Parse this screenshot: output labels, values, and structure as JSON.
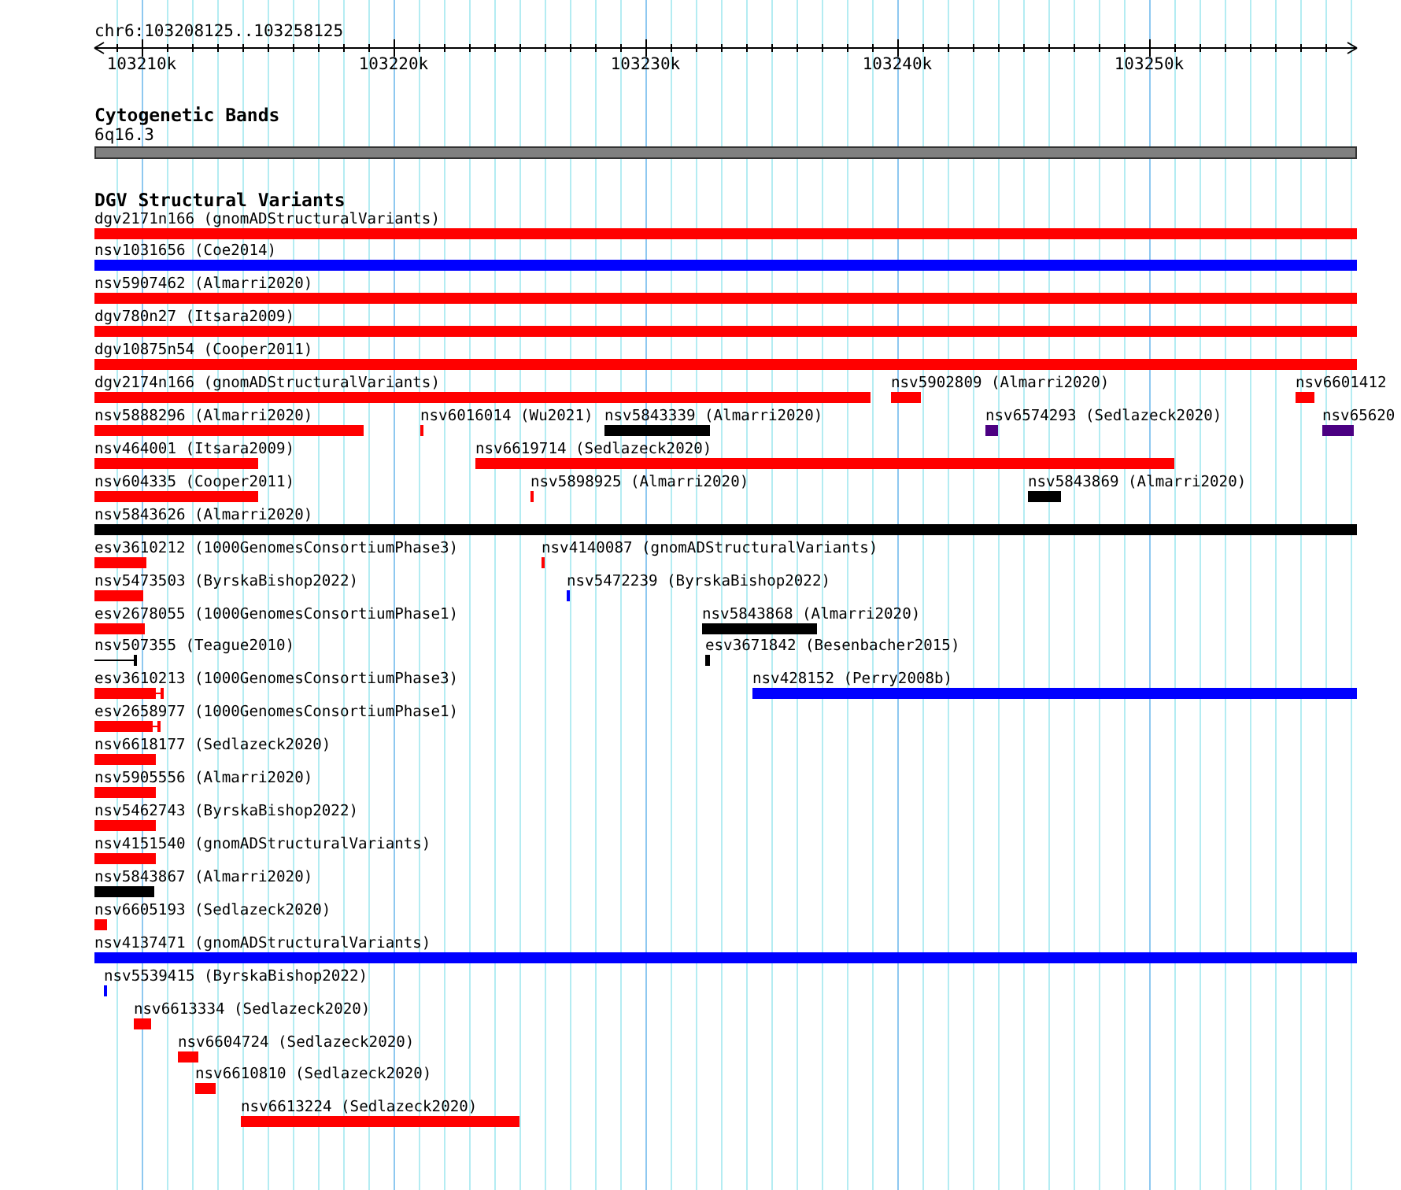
{
  "ruler": {
    "location": "chr6:103208125..103258125",
    "ticks": [
      "103210k",
      "103220k",
      "103230k",
      "103240k",
      "103250k"
    ]
  },
  "cytogenetic_track": {
    "title": "Cytogenetic Bands",
    "band": "6q16.3"
  },
  "dgv_track": {
    "title": "DGV Structural Variants",
    "features": [
      {
        "label": "dgv2171n166 (gnomADStructuralVariants)",
        "color": "#ff0000",
        "kind": "bar"
      },
      {
        "label": "nsv1031656 (Coe2014)",
        "color": "#0000ff",
        "kind": "bar"
      },
      {
        "label": "nsv5907462 (Almarri2020)",
        "color": "#ff0000",
        "kind": "bar"
      },
      {
        "label": "dgv780n27 (Itsara2009)",
        "color": "#ff0000",
        "kind": "bar"
      },
      {
        "label": "dgv10875n54 (Cooper2011)",
        "color": "#ff0000",
        "kind": "bar"
      },
      {
        "label": "dgv2174n166 (gnomADStructuralVariants)",
        "color": "#ff0000",
        "kind": "bar"
      },
      {
        "label": "nsv5902809 (Almarri2020)",
        "color": "#ff0000",
        "kind": "bar"
      },
      {
        "label": "nsv6601412",
        "color": "#ff0000",
        "kind": "bar"
      },
      {
        "label": "nsv5888296 (Almarri2020)",
        "color": "#ff0000",
        "kind": "bar"
      },
      {
        "label": "nsv6016014 (Wu2021)",
        "color": "#ff0000",
        "kind": "bar"
      },
      {
        "label": "nsv5843339 (Almarri2020)",
        "color": "#000000",
        "kind": "bar"
      },
      {
        "label": "nsv6574293 (Sedlazeck2020)",
        "color": "#4b0082",
        "kind": "bar"
      },
      {
        "label": "nsv65620",
        "color": "#4b0082",
        "kind": "bar"
      },
      {
        "label": "nsv464001 (Itsara2009)",
        "color": "#ff0000",
        "kind": "bar"
      },
      {
        "label": "nsv6619714 (Sedlazeck2020)",
        "color": "#ff0000",
        "kind": "bar"
      },
      {
        "label": "nsv604335 (Cooper2011)",
        "color": "#ff0000",
        "kind": "bar"
      },
      {
        "label": "nsv5898925 (Almarri2020)",
        "color": "#ff0000",
        "kind": "bar"
      },
      {
        "label": "nsv5843869 (Almarri2020)",
        "color": "#000000",
        "kind": "bar"
      },
      {
        "label": "nsv5843626 (Almarri2020)",
        "color": "#000000",
        "kind": "bar"
      },
      {
        "label": "esv3610212 (1000GenomesConsortiumPhase3)",
        "color": "#ff0000",
        "kind": "bar"
      },
      {
        "label": "nsv4140087 (gnomADStructuralVariants)",
        "color": "#ff0000",
        "kind": "bar"
      },
      {
        "label": "nsv5473503 (ByrskaBishop2022)",
        "color": "#ff0000",
        "kind": "bar"
      },
      {
        "label": "nsv5472239 (ByrskaBishop2022)",
        "color": "#0000ff",
        "kind": "bar"
      },
      {
        "label": "esv2678055 (1000GenomesConsortiumPhase1)",
        "color": "#ff0000",
        "kind": "bar"
      },
      {
        "label": "nsv5843868 (Almarri2020)",
        "color": "#000000",
        "kind": "bar"
      },
      {
        "label": "nsv507355 (Teague2010)",
        "color": "#000000",
        "kind": "line"
      },
      {
        "label": "esv3671842 (Besenbacher2015)",
        "color": "#000000",
        "kind": "bar"
      },
      {
        "label": "esv3610213 (1000GenomesConsortiumPhase3)",
        "color": "#ff0000",
        "kind": "capped"
      },
      {
        "label": "nsv428152 (Perry2008b)",
        "color": "#0000ff",
        "kind": "bar"
      },
      {
        "label": "esv2658977 (1000GenomesConsortiumPhase1)",
        "color": "#ff0000",
        "kind": "capped"
      },
      {
        "label": "nsv6618177 (Sedlazeck2020)",
        "color": "#ff0000",
        "kind": "bar"
      },
      {
        "label": "nsv5905556 (Almarri2020)",
        "color": "#ff0000",
        "kind": "bar"
      },
      {
        "label": "nsv5462743 (ByrskaBishop2022)",
        "color": "#ff0000",
        "kind": "bar"
      },
      {
        "label": "nsv4151540 (gnomADStructuralVariants)",
        "color": "#ff0000",
        "kind": "bar"
      },
      {
        "label": "nsv5843867 (Almarri2020)",
        "color": "#000000",
        "kind": "bar"
      },
      {
        "label": "nsv6605193 (Sedlazeck2020)",
        "color": "#ff0000",
        "kind": "bar"
      },
      {
        "label": "nsv4137471 (gnomADStructuralVariants)",
        "color": "#0000ff",
        "kind": "bar"
      },
      {
        "label": "nsv5539415 (ByrskaBishop2022)",
        "color": "#0000ff",
        "kind": "bar"
      },
      {
        "label": "nsv6613334 (Sedlazeck2020)",
        "color": "#ff0000",
        "kind": "bar"
      },
      {
        "label": "nsv6604724 (Sedlazeck2020)",
        "color": "#ff0000",
        "kind": "bar"
      },
      {
        "label": "nsv6610810 (Sedlazeck2020)",
        "color": "#ff0000",
        "kind": "bar"
      },
      {
        "label": "nsv6613224 (Sedlazeck2020)",
        "color": "#ff0000",
        "kind": "bar"
      }
    ]
  }
}
